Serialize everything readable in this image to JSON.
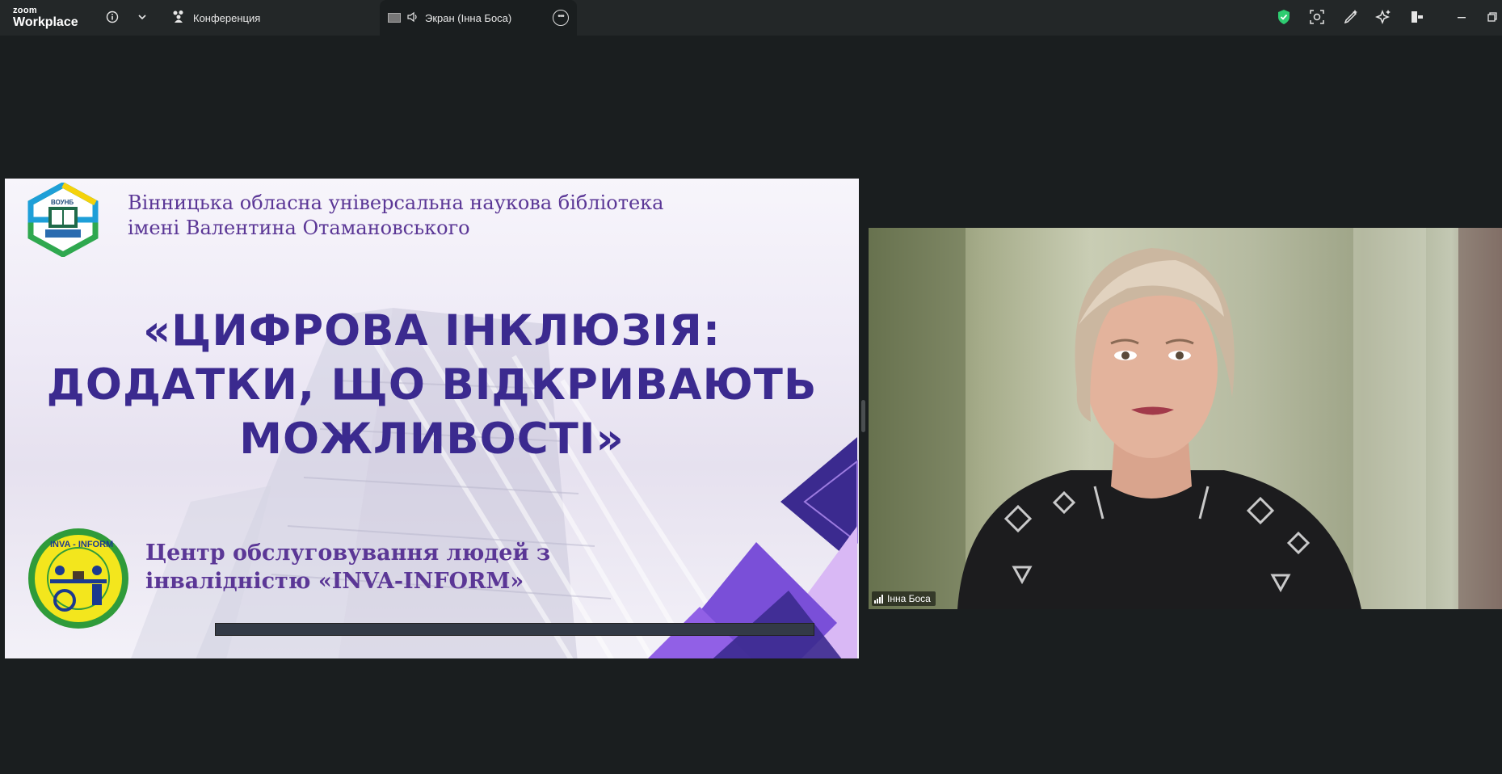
{
  "app": {
    "logo_line1": "zoom",
    "logo_line2": "Workplace"
  },
  "titlebar": {
    "info_icon": "info-icon",
    "dropdown_icon": "chevron-down-icon",
    "conference_tab_label": "Конференция",
    "screen_tab_label": "Экран (Інна Боса)",
    "right_icons": [
      "shield-check-icon",
      "reactions-icon",
      "annotate-icon",
      "ai-sparkle-icon",
      "view-icon",
      "minimize-icon",
      "restore-icon"
    ],
    "accent_color": "#2ecc71"
  },
  "slide": {
    "library_line1": "Вінницька обласна універсальна наукова бібліотека",
    "library_line2": "імені Валентина Отамановського",
    "title_line1": "«ЦИФРОВА ІНКЛЮЗІЯ:",
    "title_line2": "ДОДАТКИ, ЩО ВІДКРИВАЮТЬ",
    "title_line3": "МОЖЛИВОСТІ»",
    "center_line1": "Центр обслуговування людей з",
    "center_line2": "інвалідністю «INVA-INFORM»",
    "logo_text": "ВОУНБ",
    "inva_logo_text": "INVA - INFORM",
    "title_color": "#3b2a8f",
    "text_color": "#5b3796"
  },
  "video": {
    "participant_name": "Інна Боса"
  }
}
